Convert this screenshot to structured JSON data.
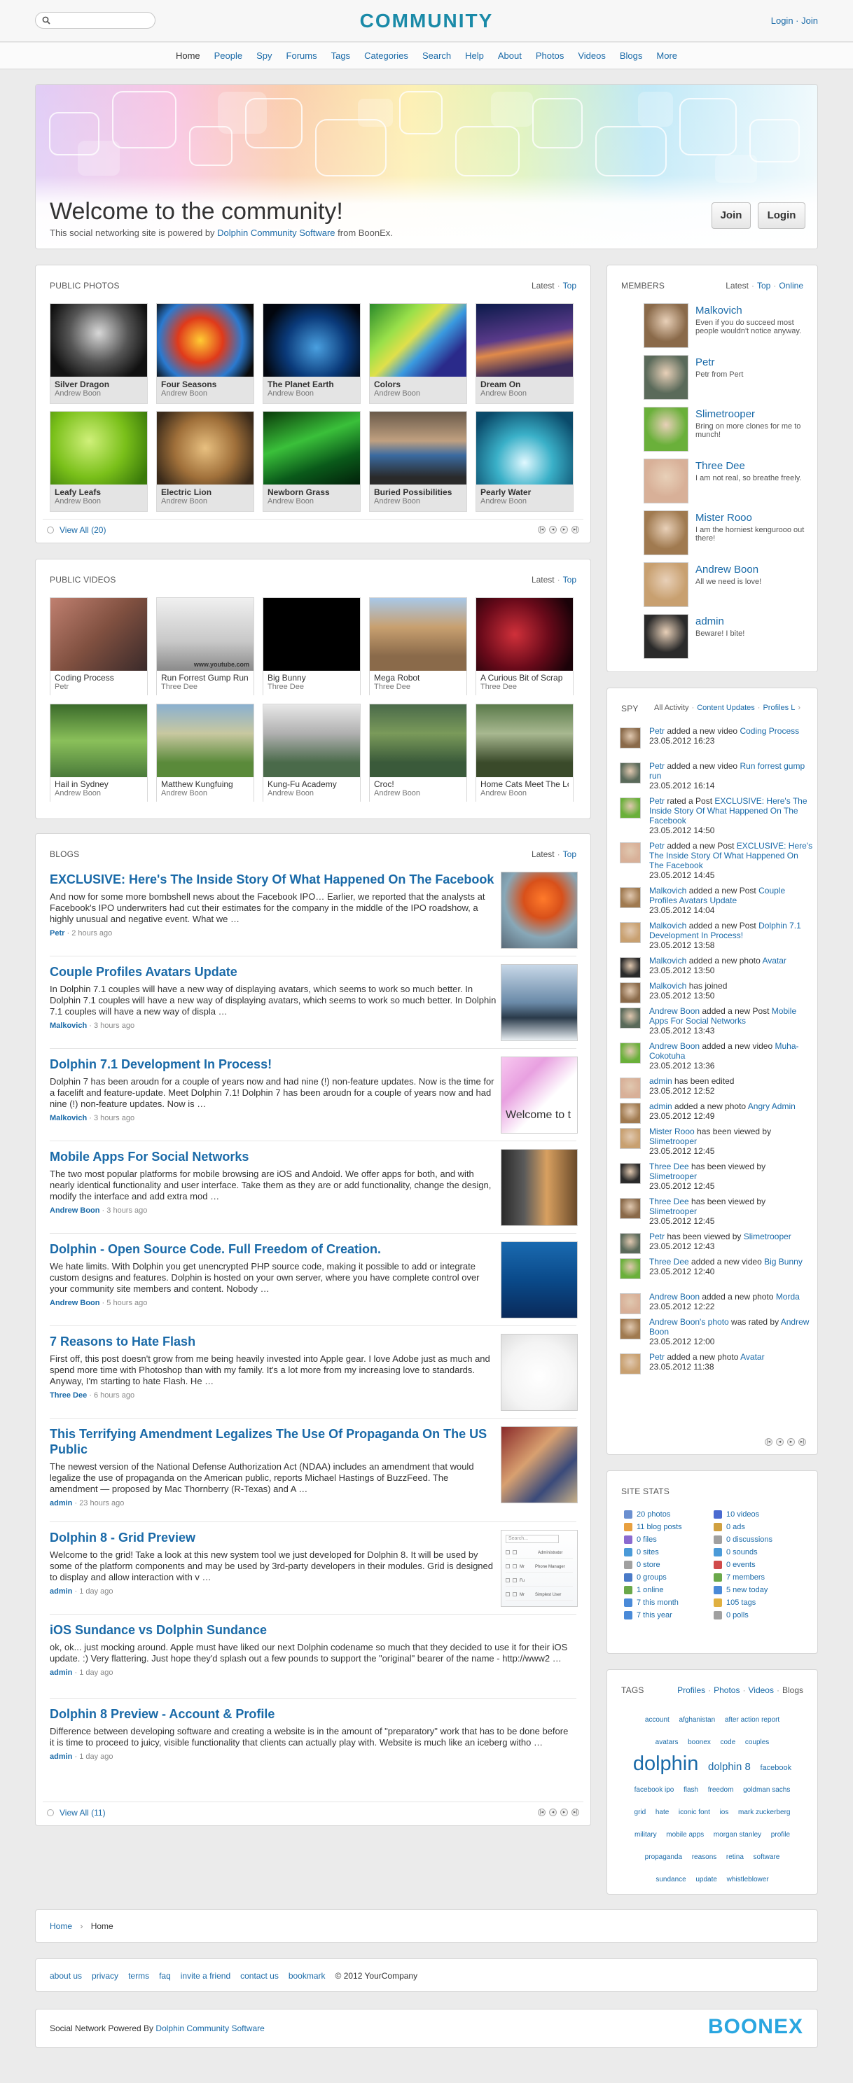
{
  "header": {
    "site_title": "COMMUNITY",
    "login": "Login",
    "join": "Join",
    "separator": "·",
    "search_placeholder": ""
  },
  "nav": [
    "Home",
    "People",
    "Spy",
    "Forums",
    "Tags",
    "Categories",
    "Search",
    "Help",
    "About",
    "Photos",
    "Videos",
    "Blogs",
    "More"
  ],
  "hero": {
    "title": "Welcome to the community!",
    "tag_prefix": "This social networking site is powered by ",
    "tag_link": "Dolphin Community Software",
    "tag_suffix": " from BoonEx.",
    "join_button": "Join",
    "login_button": "Login"
  },
  "photos": {
    "title": "Public Photos",
    "tabs": [
      "Latest",
      "Top"
    ],
    "view_all": "View All (20)",
    "items": [
      {
        "name": "Silver Dragon",
        "author": "Andrew Boon"
      },
      {
        "name": "Four Seasons",
        "author": "Andrew Boon"
      },
      {
        "name": "The Planet Earth",
        "author": "Andrew Boon"
      },
      {
        "name": "Colors",
        "author": "Andrew Boon"
      },
      {
        "name": "Dream On",
        "author": "Andrew Boon"
      },
      {
        "name": "Leafy Leafs",
        "author": "Andrew Boon"
      },
      {
        "name": "Electric Lion",
        "author": "Andrew Boon"
      },
      {
        "name": "Newborn Grass",
        "author": "Andrew Boon"
      },
      {
        "name": "Buried Possibilities",
        "author": "Andrew Boon"
      },
      {
        "name": "Pearly Water",
        "author": "Andrew Boon"
      }
    ]
  },
  "videos": {
    "title": "Public Videos",
    "tabs": [
      "Latest",
      "Top"
    ],
    "items": [
      {
        "name": "Coding Process",
        "author": "Petr"
      },
      {
        "name": "Run Forrest Gump Run",
        "author": "Three Dee"
      },
      {
        "name": "Big Bunny",
        "author": "Three Dee"
      },
      {
        "name": "Mega Robot",
        "author": "Three Dee"
      },
      {
        "name": "A Curious Bit of Scrap",
        "author": "Three Dee"
      },
      {
        "name": "Hail in Sydney",
        "author": "Andrew Boon"
      },
      {
        "name": "Matthew Kungfuing",
        "author": "Andrew Boon"
      },
      {
        "name": "Kung-Fu Academy",
        "author": "Andrew Boon"
      },
      {
        "name": "Croc!",
        "author": "Andrew Boon"
      },
      {
        "name": "Home Cats Meet The Lo",
        "author": "Andrew Boon"
      }
    ],
    "watermark": "www.youtube.com"
  },
  "blogs": {
    "title": "Blogs",
    "tabs": [
      "Latest",
      "Top"
    ],
    "view_all": "View All (11)",
    "posts": [
      {
        "title": "EXCLUSIVE: Here's The Inside Story Of What Happened On The Facebook",
        "text": "And now for some more bombshell news about the Facebook IPO… Earlier, we reported that the analysts at Facebook's IPO underwriters had cut their estimates for the company in the middle of the IPO roadshow, a highly unusual and negative event. What we …",
        "author": "Petr",
        "time": "2 hours ago"
      },
      {
        "title": "Couple Profiles Avatars Update",
        "text": "In Dolphin 7.1 couples will have a new way of displaying avatars, which seems to work so much better. In Dolphin 7.1 couples will have a new way of displaying avatars, which seems to work so much better. In Dolphin 7.1 couples will have a new way of displa …",
        "author": "Malkovich",
        "time": "3 hours ago"
      },
      {
        "title": "Dolphin 7.1 Development In Process!",
        "text": "Dolphin 7 has been aroudn for a couple of years now and had nine (!) non-feature updates. Now is the time for a facelift and feature-update. Meet Dolphin 7.1! Dolphin 7 has been aroudn for a couple of years now and had nine (!) non-feature updates. Now is …",
        "author": "Malkovich",
        "time": "3 hours ago",
        "image_text": "Welcome to t"
      },
      {
        "title": "Mobile Apps For Social Networks",
        "text": "The two most popular platforms for mobile browsing are iOS and Andoid. We offer apps for both, and with nearly identical functionality and user interface. Take them as they are or add functionality, change the design, modify the interface and add extra mod …",
        "author": "Andrew Boon",
        "time": "3 hours ago"
      },
      {
        "title": "Dolphin - Open Source Code. Full Freedom of Creation.",
        "text": "We hate limits. With Dolphin you get unencrypted PHP source code, making it possible to add or integrate custom designs and features. Dolphin is hosted on your own server, where you have complete control over your community site members and content. Nobody …",
        "author": "Andrew Boon",
        "time": "5 hours ago"
      },
      {
        "title": "7 Reasons to Hate Flash",
        "text": "First off, this post doesn't grow from me being heavily invested into Apple gear. I love Adobe just as much and spend more time with Photoshop than with my family. It's a lot more from my increasing love to standards. Anyway, I'm starting to hate Flash. He …",
        "author": "Three Dee",
        "time": "6 hours ago"
      },
      {
        "title": "This Terrifying Amendment Legalizes The Use Of Propaganda On The US Public",
        "text": "The newest version of the National Defense Authorization Act (NDAA) includes an amendment that would legalize the use of propaganda on the American public, reports Michael Hastings of BuzzFeed.  The amendment — proposed by Mac Thornberry (R-Texas) and A …",
        "author": "admin",
        "time": "23 hours ago"
      },
      {
        "title": "Dolphin 8 - Grid Preview",
        "text": "Welcome to the grid! Take a look at this new system tool we just developed for Dolphin 8. It will be used by some of the platform components and may be used by 3rd-party developers in their modules. Grid is designed to display and allow interaction with v …",
        "author": "admin",
        "time": "1 day ago"
      },
      {
        "title": "iOS Sundance vs Dolphin Sundance",
        "text": "ok, ok... just mocking around. Apple must have liked our next Dolphin codename so much that they decided to use it for their iOS update. :) Very flattering. Just hope they'd splash out a few pounds to support the \"original\" bearer of the name - http://www2 …",
        "author": "admin",
        "time": "1 day ago"
      },
      {
        "title": "Dolphin 8 Preview - Account & Profile",
        "text": "Difference between developing software and creating a website is in the amount of \"preparatory\" work that has to be done before it is time to proceed to juicy, visible functionality that clients can actually play with. Website is much like an iceberg witho …",
        "author": "admin",
        "time": "1 day ago"
      }
    ],
    "grid_preview": {
      "search": "Search...",
      "rows": [
        [
          "Administrator"
        ],
        [
          "Mr",
          "Phone Manager"
        ],
        [
          "Fu"
        ],
        [
          "Mr",
          "Simplest User"
        ]
      ]
    }
  },
  "members": {
    "title": "Members",
    "tabs": [
      "Latest",
      "Top",
      "Online"
    ],
    "items": [
      {
        "name": "Malkovich",
        "status": "Even if you do succeed most people wouldn't notice anyway."
      },
      {
        "name": "Petr",
        "status": "Petr from Pert"
      },
      {
        "name": "Slimetrooper",
        "status": "Bring on more clones for me to munch!"
      },
      {
        "name": "Three Dee",
        "status": "I am not real, so breathe freely."
      },
      {
        "name": "Mister Rooo",
        "status": "I am the horniest kengurooo out there!"
      },
      {
        "name": "Andrew Boon",
        "status": "All we need is love!"
      },
      {
        "name": "admin",
        "status": "Beware! I bite!"
      }
    ]
  },
  "spy": {
    "title": "Spy",
    "tabs": [
      "All Activity",
      "Content Updates",
      "Profiles L"
    ],
    "items": [
      {
        "user": "Petr",
        "action": " added a new video ",
        "target": "Coding Process",
        "time": "23.05.2012 16:23"
      },
      {
        "user": "Petr",
        "action": " added a new video ",
        "target": "Run forrest gump run",
        "time": "23.05.2012 16:14"
      },
      {
        "user": "Petr",
        "action": " rated a Post ",
        "target": "EXCLUSIVE: Here's The Inside Story Of What Happened On The Facebook",
        "time": "23.05.2012 14:50"
      },
      {
        "user": "Petr",
        "action": " added a new Post ",
        "target": "EXCLUSIVE: Here's The Inside Story Of What Happened On The Facebook",
        "time": "23.05.2012 14:45"
      },
      {
        "user": "Malkovich",
        "action": " added a new Post ",
        "target": "Couple Profiles Avatars Update",
        "time": "23.05.2012 14:04"
      },
      {
        "user": "Malkovich",
        "action": " added a new Post ",
        "target": "Dolphin 7.1 Development In Process!",
        "time": "23.05.2012 13:58"
      },
      {
        "user": "Malkovich",
        "action": " added a new photo ",
        "target": "Avatar",
        "time": "23.05.2012 13:50"
      },
      {
        "user": "Malkovich",
        "action": " has joined",
        "target": "",
        "time": "23.05.2012 13:50"
      },
      {
        "user": "Andrew Boon",
        "action": " added a new Post ",
        "target": "Mobile Apps For Social Networks",
        "time": "23.05.2012 13:43"
      },
      {
        "user": "Andrew Boon",
        "action": " added a new video ",
        "target": "Muha-Cokotuha",
        "time": "23.05.2012 13:36"
      },
      {
        "user": "admin",
        "action": " has been edited",
        "target": "",
        "time": "23.05.2012 12:52"
      },
      {
        "user": "admin",
        "action": " added a new photo ",
        "target": "Angry Admin",
        "time": "23.05.2012 12:49"
      },
      {
        "user": "Mister Rooo",
        "action": " has been viewed by ",
        "target": "Slimetrooper",
        "time": "23.05.2012 12:45"
      },
      {
        "user": "Three Dee",
        "action": " has been viewed by ",
        "target": "Slimetrooper",
        "time": "23.05.2012 12:45"
      },
      {
        "user": "Three Dee",
        "action": " has been viewed by ",
        "target": "Slimetrooper",
        "time": "23.05.2012 12:45"
      },
      {
        "user": "Petr",
        "action": " has been viewed by ",
        "target": "Slimetrooper",
        "time": "23.05.2012 12:43"
      },
      {
        "user": "Three Dee",
        "action": " added a new video ",
        "target": "Big Bunny",
        "time": "23.05.2012 12:40"
      },
      {
        "user": "Andrew Boon",
        "action": " added a new photo ",
        "target": "Morda",
        "time": "23.05.2012 12:22"
      },
      {
        "user": "Andrew Boon's photo",
        "action": " was rated by ",
        "target": "Andrew Boon",
        "time": "23.05.2012 12:00"
      },
      {
        "user": "Petr",
        "action": " added a new photo ",
        "target": "Avatar",
        "time": "23.05.2012 11:38"
      }
    ]
  },
  "stats": {
    "title": "Site Stats",
    "left": [
      {
        "label": "20 photos",
        "icon": "photo-icon",
        "color": "#6a8fd0"
      },
      {
        "label": "11 blog posts",
        "icon": "blog-icon",
        "color": "#e8a040"
      },
      {
        "label": "0 files",
        "icon": "files-icon",
        "color": "#8a6ad0"
      },
      {
        "label": "0 sites",
        "icon": "sites-icon",
        "color": "#4a9ad8"
      },
      {
        "label": "0 store",
        "icon": "store-icon",
        "color": "#a0a0a0"
      },
      {
        "label": "0 groups",
        "icon": "groups-icon",
        "color": "#4a7ac8"
      },
      {
        "label": "1 online",
        "icon": "online-icon",
        "color": "#6aa84a"
      },
      {
        "label": "7 this month",
        "icon": "month-icon",
        "color": "#4a8ad8"
      },
      {
        "label": "7 this year",
        "icon": "year-icon",
        "color": "#4a8ad8"
      }
    ],
    "right": [
      {
        "label": "10 videos",
        "icon": "video-icon",
        "color": "#4a6ad0"
      },
      {
        "label": "0 ads",
        "icon": "ads-icon",
        "color": "#d0a040"
      },
      {
        "label": "0 discussions",
        "icon": "discussions-icon",
        "color": "#a0a0a0"
      },
      {
        "label": "0 sounds",
        "icon": "sounds-icon",
        "color": "#4a9ad8"
      },
      {
        "label": "0 events",
        "icon": "events-icon",
        "color": "#d04a4a"
      },
      {
        "label": "7 members",
        "icon": "members-icon",
        "color": "#6aa84a"
      },
      {
        "label": "5 new today",
        "icon": "today-icon",
        "color": "#4a8ad8"
      },
      {
        "label": "105 tags",
        "icon": "tags-icon",
        "color": "#e0b040"
      },
      {
        "label": "0 polls",
        "icon": "polls-icon",
        "color": "#a0a0a0"
      }
    ]
  },
  "tags": {
    "title": "Tags",
    "tabs": [
      "Profiles",
      "Photos",
      "Videos",
      "Blogs"
    ],
    "cloud": [
      {
        "t": "account",
        "s": 9
      },
      {
        "t": "afghanistan",
        "s": 9
      },
      {
        "t": "after action report",
        "s": 9
      },
      {
        "t": "avatars",
        "s": 9
      },
      {
        "t": "boonex",
        "s": 9
      },
      {
        "t": "code",
        "s": 9
      },
      {
        "t": "couples",
        "s": 9
      },
      {
        "t": "dolphin",
        "s": 28
      },
      {
        "t": "dolphin 8",
        "s": 14
      },
      {
        "t": "facebook",
        "s": 10
      },
      {
        "t": "facebook ipo",
        "s": 9
      },
      {
        "t": "flash",
        "s": 9
      },
      {
        "t": "freedom",
        "s": 9
      },
      {
        "t": "goldman sachs",
        "s": 9
      },
      {
        "t": "grid",
        "s": 9
      },
      {
        "t": "hate",
        "s": 9
      },
      {
        "t": "iconic font",
        "s": 9
      },
      {
        "t": "ios",
        "s": 9
      },
      {
        "t": "mark zuckerberg",
        "s": 9
      },
      {
        "t": "military",
        "s": 9
      },
      {
        "t": "mobile apps",
        "s": 9
      },
      {
        "t": "morgan stanley",
        "s": 9
      },
      {
        "t": "profile",
        "s": 9
      },
      {
        "t": "propaganda",
        "s": 9
      },
      {
        "t": "reasons",
        "s": 9
      },
      {
        "t": "retina",
        "s": 9
      },
      {
        "t": "software",
        "s": 9
      },
      {
        "t": "sundance",
        "s": 9
      },
      {
        "t": "update",
        "s": 9
      },
      {
        "t": "whistleblower",
        "s": 9
      }
    ]
  },
  "breadcrumb": [
    "Home",
    "Home"
  ],
  "footer": {
    "links": [
      "about us",
      "privacy",
      "terms",
      "faq",
      "invite a friend",
      "contact us",
      "bookmark"
    ],
    "copyright": "© 2012 YourCompany",
    "powered_prefix": "Social Network Powered By ",
    "powered_link": "Dolphin Community Software",
    "brand": "BOONEX"
  }
}
